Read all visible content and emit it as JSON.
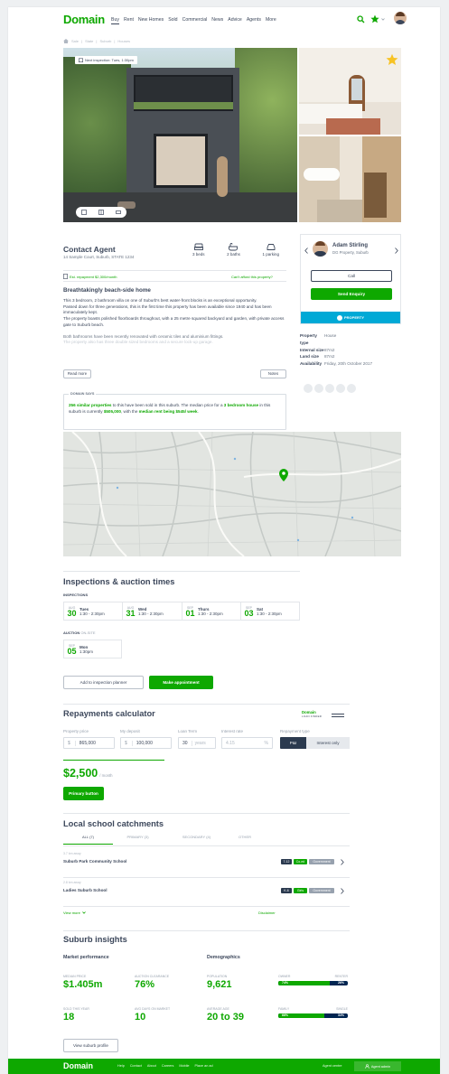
{
  "brand": {
    "name": "Domain",
    "color": "#0ea800"
  },
  "nav": {
    "items": [
      "Buy",
      "Rent",
      "New Homes",
      "Sold",
      "Commercial",
      "News",
      "Advice",
      "Agents",
      "More"
    ],
    "active": "Buy"
  },
  "header_icons": {
    "search": "search-icon",
    "shortlist": "star-icon",
    "avatar": "user-avatar"
  },
  "breadcrumb": [
    "Sale",
    "State",
    "Suburb",
    "Houses"
  ],
  "gallery": {
    "next_inspection": "Next inspection: Tues, 1:30pm"
  },
  "listing": {
    "title": "Contact Agent",
    "address": "14 Sample Court, Suburb, STATE 1234",
    "beds": "3 beds",
    "baths": "2 baths",
    "parking": "1 parking",
    "repayment_link": "Est. repayment $2,300/month",
    "afford_link": "Can't afford this property?",
    "headline": "Breathtakingly beach-side home",
    "description": [
      "This 3 bedroom, 2 bathroom villa on one of Suburb's best water-front blocks is an exceptional opportunity.",
      "Passed down for three generations, this is the first time this property has been available since 1940 and has been immaculately kept.",
      "The property boasts polished floorboards throughout, with a 25 metre squared backyard and garden, with private access gate to Suburb beach.",
      "Both bathrooms have been recently renovated with ceramic tiles and aluminium fittings.",
      "The property also has three double sized bedrooms and a secure lock-up garage."
    ],
    "read_more": "Read more",
    "notes": "Notes",
    "domain_says_title": "DOMAIN SAYS",
    "domain_says_parts": [
      "256 similar properties",
      " to this have been sold in this suburb. The median price for a ",
      "3 bedroom house",
      " in this suburb is currently ",
      "$505,000",
      ", with the ",
      "median rent being $545/ week",
      "."
    ]
  },
  "agent": {
    "name": "Adam Stirling",
    "agency": "DG Property, Suburb",
    "call": "Call",
    "enquiry": "Send Enquiry",
    "agency_badge": "PROPERTY",
    "agency_color": "#00a9d6",
    "details": [
      {
        "label": "Property type",
        "value": "House"
      },
      {
        "label": "Internal size",
        "value": "87m2"
      },
      {
        "label": "Land size",
        "value": "87m2"
      },
      {
        "label": "Availability",
        "value": "Friday, 20th October 2017"
      }
    ],
    "share_icons": [
      "print-icon",
      "mail-icon",
      "facebook-icon",
      "twitter-icon",
      "googleplus-icon"
    ]
  },
  "inspections": {
    "title": "Inspections & auction times",
    "subtitle": "INSPECTIONS",
    "dates": [
      {
        "month": "AUG",
        "day": "30",
        "dow": "Tues",
        "time": "1:30 - 2:30pm"
      },
      {
        "month": "AUG",
        "day": "31",
        "dow": "Wed",
        "time": "1:30 - 2:30pm"
      },
      {
        "month": "SEP",
        "day": "01",
        "dow": "Thurs",
        "time": "1:30 - 2:30pm"
      },
      {
        "month": "SEP",
        "day": "03",
        "dow": "Sat",
        "time": "1:30 - 2:30pm"
      }
    ],
    "auction_label": "AUCTION",
    "auction_sub": "ON-SITE",
    "auction": {
      "month": "SEP",
      "day": "05",
      "dow": "Mon",
      "time": "1:30pm"
    },
    "planner_btn": "Add to inspection planner",
    "appointment_btn": "Make appointment"
  },
  "calculator": {
    "title": "Repayments calculator",
    "logo": "Domain",
    "logo_sub": "LOAN FINDER",
    "fields": {
      "price_label": "Property price",
      "price_prefix": "$",
      "price": "865,000",
      "deposit_label": "My deposit",
      "deposit_prefix": "$",
      "deposit": "100,000",
      "term_label": "Loan Term",
      "term": "30",
      "term_unit": "years",
      "rate_label": "Interest rate",
      "rate": "4.15",
      "rate_unit": "%",
      "type_label": "Repayment type",
      "type_a": "P&I",
      "type_b": "Interest only"
    },
    "result": "$2,500",
    "result_unit": "/ month",
    "primary_btn": "Primary button"
  },
  "schools": {
    "title": "Local school catchments",
    "tabs": [
      "ALL (7)",
      "PRIMARY (3)",
      "SECONDARY (4)",
      "OTHER"
    ],
    "items": [
      {
        "distance": "3.7 km away",
        "name": "Suburb Park Community School",
        "years": "7-12",
        "gender": "Co-ed",
        "sector": "Government"
      },
      {
        "distance": "2.8 km away",
        "name": "Ladies Suburb School",
        "years": "K-6",
        "gender": "Girls",
        "sector": "Government"
      }
    ],
    "view_more": "View more",
    "disclaimer": "Disclaimer"
  },
  "insights": {
    "title": "Suburb insights",
    "market_title": "Market performance",
    "demo_title": "Demographics",
    "stats": [
      {
        "label": "MEDIAN PRICE",
        "value": "$1.405m"
      },
      {
        "label": "AUCTION CLEARANCE",
        "value": "76%"
      },
      {
        "label": "SOLD THIS YEAR",
        "value": "18"
      },
      {
        "label": "AVG DAYS ON MARKET",
        "value": "10"
      }
    ],
    "demo_stats": [
      {
        "label": "POPULATION",
        "value": "9,621"
      },
      {
        "label": "AVERAGE AGE",
        "value": "20 to 39"
      }
    ],
    "bars": [
      {
        "left_label": "OWNER",
        "right_label": "RENTER",
        "left_pct": "74%",
        "right_pct": "26%",
        "fill": 0.74
      },
      {
        "left_label": "FAMILY",
        "right_label": "SINGLE",
        "left_pct": "66%",
        "right_pct": "34%",
        "fill": 0.66
      }
    ],
    "profile_btn": "View suburb profile"
  },
  "footer": {
    "brand": "Domain",
    "links": [
      "Help",
      "Contact",
      "About",
      "Careers",
      "Mobile",
      "Place an ad"
    ],
    "agent_centre": "Agent centre",
    "agent_admin": "Agent admin"
  }
}
